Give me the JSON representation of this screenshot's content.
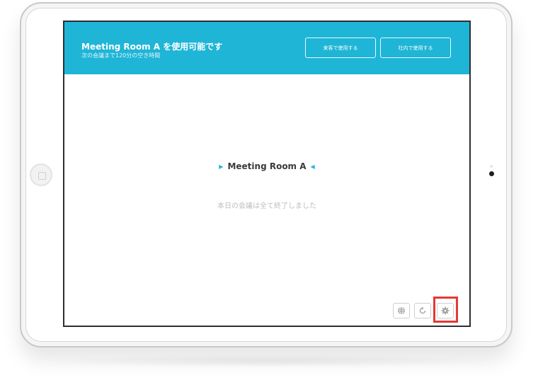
{
  "header": {
    "title": "Meeting Room A を使用可能です",
    "subtitle": "次の会議まで120分の空き時間",
    "guest_button_label": "来客で使用する",
    "internal_button_label": "社内で使用する"
  },
  "main": {
    "room_name": "Meeting Room A",
    "status_message": "本日の会議は全て終了しました"
  },
  "toolbar": {
    "icons": [
      "globe-icon",
      "refresh-icon",
      "gear-icon"
    ]
  },
  "colors": {
    "accent": "#1fb5d6",
    "highlight": "#e53935"
  }
}
